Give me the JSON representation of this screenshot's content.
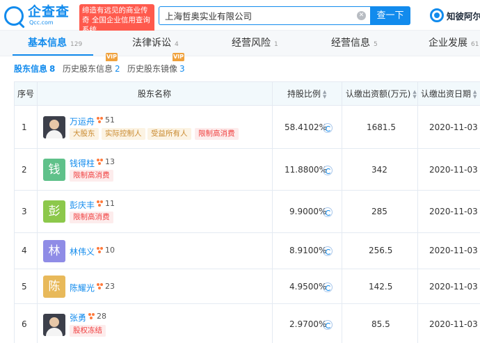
{
  "header": {
    "logo_name": "企查查",
    "logo_domain": "Qcc.com",
    "slogan": "缔造有远见的商业传奇 全国企业信用查询系统",
    "search_value": "上海哲奥实业有限公司",
    "search_button": "查一下",
    "clear_icon": "close-icon",
    "brand_link": "知彼阿尔"
  },
  "main_tabs": [
    {
      "label": "基本信息",
      "count": "129",
      "active": true
    },
    {
      "label": "法律诉讼",
      "count": "4"
    },
    {
      "label": "经营风险",
      "count": "1"
    },
    {
      "label": "经营信息",
      "count": "5"
    },
    {
      "label": "企业发展",
      "count": "61"
    }
  ],
  "sub_tabs": [
    {
      "label": "股东信息",
      "count": "8",
      "active": true
    },
    {
      "label": "历史股东信息",
      "count": "2"
    },
    {
      "label": "历史股东镜像",
      "count": "3"
    }
  ],
  "vip_label": "VIP",
  "colors": {
    "accent": "#128bed",
    "slogan_bg": "#ff5a4d",
    "vip": "#f0a13c",
    "tag_red": "#f04040",
    "tag_gold": "#c98a2f"
  },
  "table": {
    "headers": {
      "index": "序号",
      "name": "股东名称",
      "ratio": "持股比例",
      "capital": "认缴出资额(万元)",
      "date": "认缴出资日期"
    },
    "rows": [
      {
        "index": "1",
        "avatar": "",
        "avatar_type": "photo",
        "name": "万运舟",
        "relations": "51",
        "tags": [
          {
            "text": "大股东",
            "style": "gold"
          },
          {
            "text": "实际控制人",
            "style": "gold"
          },
          {
            "text": "受益所有人",
            "style": "gold"
          },
          {
            "text": "限制高消费",
            "style": "red"
          }
        ],
        "ratio": "58.4102%",
        "capital": "1681.5",
        "date": "2020-11-03"
      },
      {
        "index": "2",
        "avatar": "钱",
        "avatar_color": "#5fc18a",
        "name": "钱得柱",
        "relations": "13",
        "tags": [
          {
            "text": "限制高消费",
            "style": "red"
          }
        ],
        "ratio": "11.8800%",
        "capital": "342",
        "date": "2020-11-03"
      },
      {
        "index": "3",
        "avatar": "彭",
        "avatar_color": "#8cc84b",
        "name": "彭庆丰",
        "relations": "11",
        "tags": [
          {
            "text": "限制高消费",
            "style": "red"
          }
        ],
        "ratio": "9.9000%",
        "capital": "285",
        "date": "2020-11-03"
      },
      {
        "index": "4",
        "avatar": "林",
        "avatar_color": "#8f8ce6",
        "name": "林伟义",
        "relations": "10",
        "tags": [],
        "ratio": "8.9100%",
        "capital": "256.5",
        "date": "2020-11-03"
      },
      {
        "index": "5",
        "avatar": "陈",
        "avatar_color": "#e8b95a",
        "name": "陈耀光",
        "relations": "23",
        "tags": [],
        "ratio": "4.9500%",
        "capital": "142.5",
        "date": "2020-11-03"
      },
      {
        "index": "6",
        "avatar": "",
        "avatar_type": "photo",
        "name": "张勇",
        "relations": "28",
        "tags": [
          {
            "text": "股权冻结",
            "style": "red"
          }
        ],
        "ratio": "2.9700%",
        "capital": "85.5",
        "date": "2020-11-03"
      }
    ]
  }
}
